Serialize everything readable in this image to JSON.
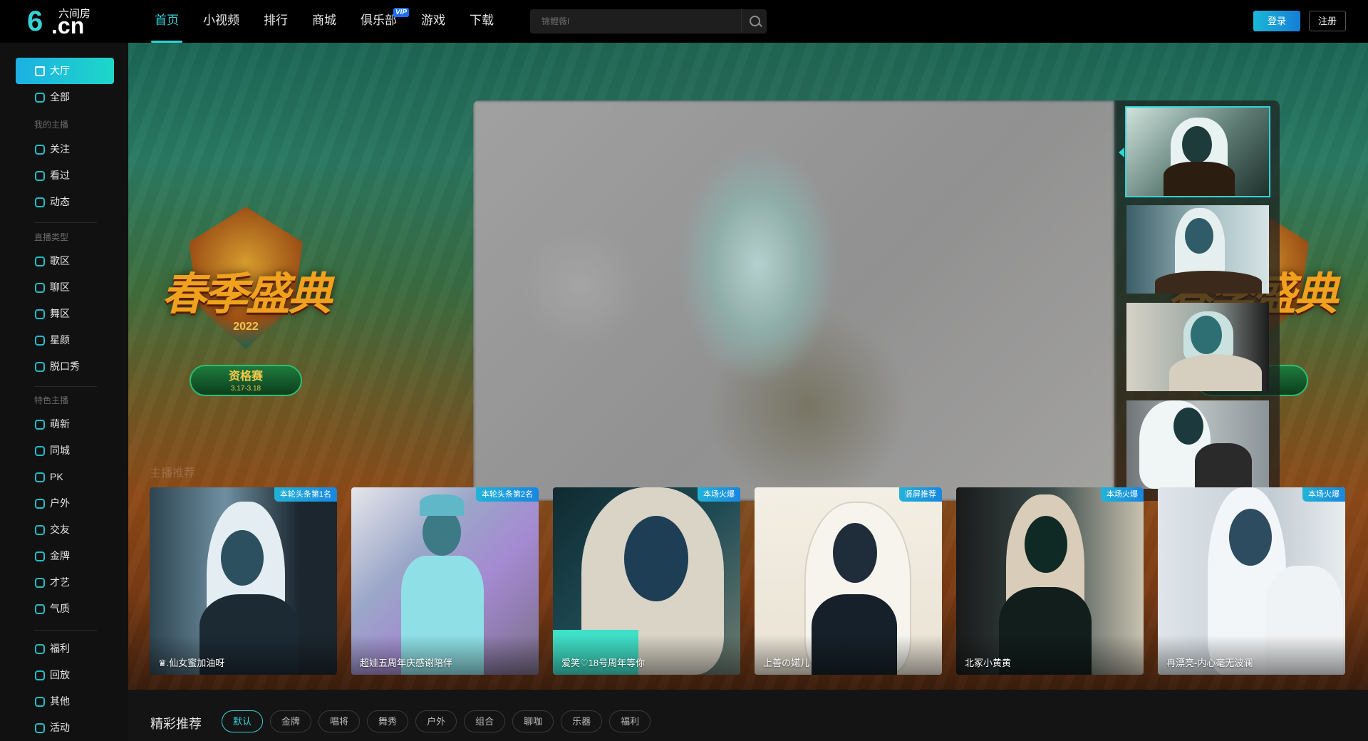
{
  "header": {
    "logo_cn": ".cn",
    "logo_six": "6",
    "logo_name": "六间房",
    "nav": [
      {
        "label": "首页",
        "active": true
      },
      {
        "label": "小视频"
      },
      {
        "label": "排行"
      },
      {
        "label": "商城"
      },
      {
        "label": "俱乐部",
        "badge": "VIP"
      },
      {
        "label": "游戏"
      },
      {
        "label": "下载"
      }
    ],
    "search_placeholder": "锦鲤薇I",
    "login_label": "登录",
    "register_label": "注册"
  },
  "sidebar": {
    "top_items": [
      {
        "label": "大厅",
        "icon": "home-icon",
        "active": true
      },
      {
        "label": "全部",
        "icon": "grid-icon"
      }
    ],
    "my_anchor_heading": "我的主播",
    "my_anchor_items": [
      {
        "label": "关注",
        "icon": "heart-icon"
      },
      {
        "label": "看过",
        "icon": "clock-icon"
      },
      {
        "label": "动态",
        "icon": "chat-icon"
      }
    ],
    "live_type_heading": "直播类型",
    "live_type_items": [
      {
        "label": "歌区",
        "icon": "music-icon"
      },
      {
        "label": "聊区",
        "icon": "chat-icon"
      },
      {
        "label": "舞区",
        "icon": "dance-icon"
      },
      {
        "label": "星颜",
        "icon": "mask-icon"
      },
      {
        "label": "脱口秀",
        "icon": "mic-icon"
      }
    ],
    "featured_heading": "特色主播",
    "featured_items": [
      {
        "label": "萌新",
        "icon": "leaf-icon"
      },
      {
        "label": "同城",
        "icon": "location-icon"
      },
      {
        "label": "PK",
        "icon": "lightning-icon"
      },
      {
        "label": "户外",
        "icon": "mountain-icon"
      },
      {
        "label": "交友",
        "icon": "people-icon"
      },
      {
        "label": "金牌",
        "icon": "medal-icon"
      },
      {
        "label": "才艺",
        "icon": "tag-icon"
      },
      {
        "label": "气质",
        "icon": "boot-icon"
      }
    ],
    "bottom_items": [
      {
        "label": "福利",
        "icon": "gift-icon"
      },
      {
        "label": "回放",
        "icon": "replay-icon"
      },
      {
        "label": "其他",
        "icon": "dots-icon"
      },
      {
        "label": "活动",
        "icon": "star-icon"
      }
    ]
  },
  "hero": {
    "event_title": "春季盛典",
    "event_year": "2022",
    "event_stage": "资格赛",
    "event_dates": "3.17-3.18",
    "ghost_heading": "主播推荐"
  },
  "cards": [
    {
      "tag": "本轮头条第1名",
      "name": "♛.仙女蜜加油呀"
    },
    {
      "tag": "本轮头条第2名",
      "name": "超娃五周年庆感谢陪伴"
    },
    {
      "tag": "本场火爆",
      "name": "爱笑♡18号周年等你"
    },
    {
      "tag": "竖屏推荐",
      "name": "上善の婼儿"
    },
    {
      "tag": "本场火爆",
      "name": "北冢小黄黄"
    },
    {
      "tag": "本场火爆",
      "name": "冉漂亮-内心毫无波澜"
    }
  ],
  "recommend": {
    "title": "精彩推荐",
    "chips": [
      "默认",
      "金牌",
      "唱将",
      "舞秀",
      "户外",
      "组合",
      "聊咖",
      "乐器",
      "福利"
    ],
    "active_chip": "默认"
  },
  "colors": {
    "accent": "#34d3d6",
    "tag_gradient_start": "#21b3d8",
    "tag_gradient_end": "#1986e0"
  }
}
